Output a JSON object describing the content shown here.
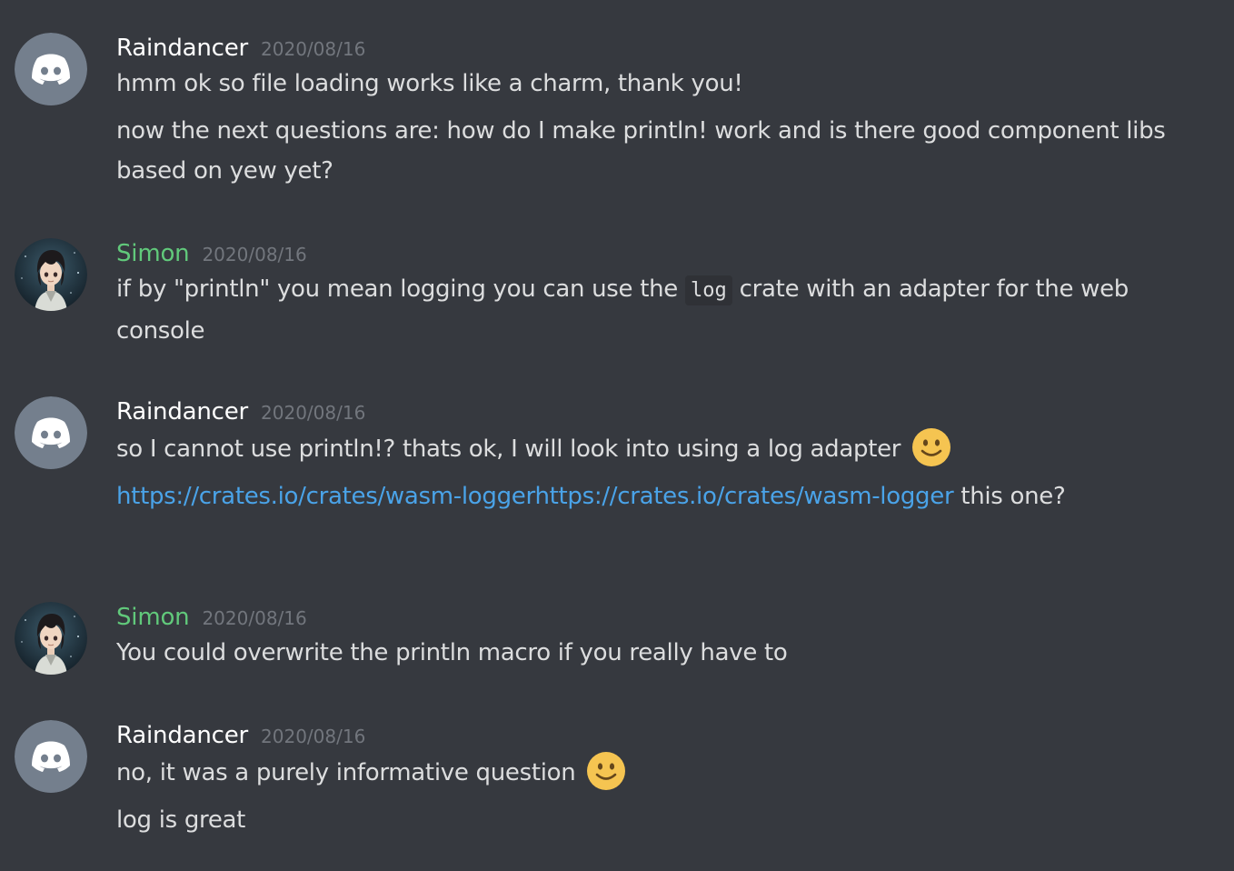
{
  "colors": {
    "background": "#36393f",
    "username_default": "#ffffff",
    "username_green": "#61c97b",
    "timestamp": "#72767d",
    "text": "#dcddde",
    "link": "#4aa3e8",
    "discord_avatar_bg": "#747f8d"
  },
  "groups": [
    {
      "author": "Raindancer",
      "avatar": "discord-default-avatar-icon",
      "timestamp": "2020/08/16",
      "messages": [
        {
          "text": "hmm ok so file loading works like a charm, thank you!"
        },
        {
          "text": "now the next questions are: how do I make println! work and is there good component libs based on yew yet?"
        }
      ]
    },
    {
      "author": "Simon",
      "avatar": "anime-character-avatar",
      "timestamp": "2020/08/16",
      "messages": [
        {
          "before": "if by \"println\" you mean logging you can use the ",
          "code": "log",
          "after": " crate with an adapter for the web console"
        }
      ]
    },
    {
      "author": "Raindancer",
      "avatar": "discord-default-avatar-icon",
      "timestamp": "2020/08/16",
      "messages": [
        {
          "text": "so I cannot use println!? thats ok, I will look into using a log adapter ",
          "emoji": "slight-smile-emoji"
        },
        {
          "link": "https://crates.io/crates/wasm-loggerhttps://crates.io/crates/wasm-logger",
          "after": " this one?"
        }
      ]
    },
    {
      "author": "Simon",
      "avatar": "anime-character-avatar",
      "timestamp": "2020/08/16",
      "messages": [
        {
          "text": "You could overwrite the println macro if you really have to"
        }
      ]
    },
    {
      "author": "Raindancer",
      "avatar": "discord-default-avatar-icon",
      "timestamp": "2020/08/16",
      "messages": [
        {
          "text": "no, it was a purely informative question ",
          "emoji": "slight-smile-emoji"
        },
        {
          "text": "log is great"
        }
      ]
    }
  ]
}
